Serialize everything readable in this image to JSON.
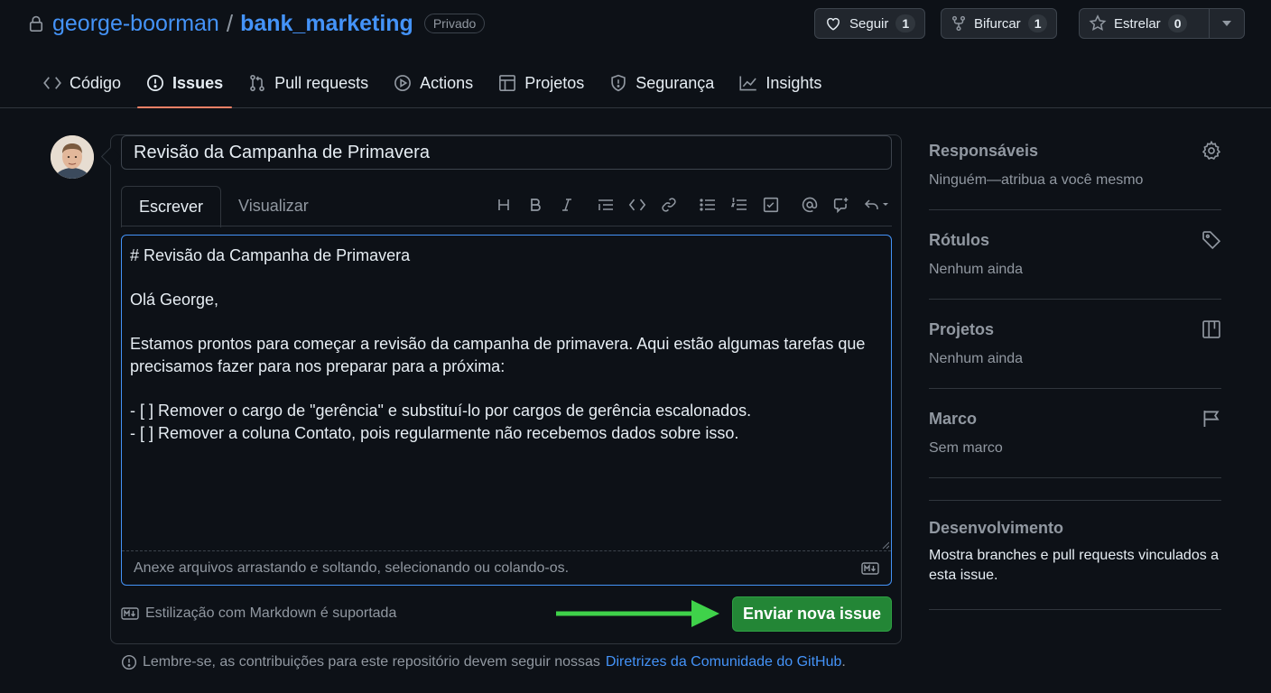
{
  "repo": {
    "owner": "george-boorman",
    "separator": "/",
    "name": "bank_marketing",
    "visibility": "Privado"
  },
  "actions": {
    "watch": {
      "label": "Seguir",
      "count": "1"
    },
    "fork": {
      "label": "Bifurcar",
      "count": "1"
    },
    "star": {
      "label": "Estrelar",
      "count": "0"
    }
  },
  "tabs": [
    {
      "label": "Código",
      "icon": "code-icon"
    },
    {
      "label": "Issues",
      "icon": "issue-icon",
      "active": true
    },
    {
      "label": "Pull requests",
      "icon": "pull-request-icon"
    },
    {
      "label": "Actions",
      "icon": "play-icon"
    },
    {
      "label": "Projetos",
      "icon": "table-icon"
    },
    {
      "label": "Segurança",
      "icon": "shield-icon"
    },
    {
      "label": "Insights",
      "icon": "graph-icon"
    }
  ],
  "issue": {
    "title": "Revisão da Campanha de Primavera",
    "body": "# Revisão da Campanha de Primavera\n\nOlá George,\n\nEstamos prontos para começar a revisão da campanha de primavera. Aqui estão algumas tarefas que precisamos fazer para nos preparar para a próxima:\n\n- [ ] Remover o cargo de \"gerência\" e substituí-lo por cargos de gerência escalonados.\n- [ ] Remover a coluna Contato, pois regularmente não recebemos dados sobre isso."
  },
  "editor": {
    "tab_write": "Escrever",
    "tab_preview": "Visualizar",
    "toolbar": [
      "heading-icon",
      "bold-icon",
      "italic-icon",
      "quote-icon",
      "code-icon",
      "link-icon",
      "unordered-list-icon",
      "ordered-list-icon",
      "task-list-icon",
      "mention-icon",
      "reference-icon",
      "undo-icon"
    ],
    "attach_hint": "Anexe arquivos arrastando e soltando, selecionando ou colando-os.",
    "markdown_note": "Estilização com Markdown é suportada",
    "submit_label": "Enviar nova issue"
  },
  "guidelines": {
    "text": "Lembre-se, as contribuições para este repositório devem seguir nossas",
    "link": "Diretrizes da Comunidade do GitHub",
    "end": "."
  },
  "sidebar": {
    "assignees": {
      "title": "Responsáveis",
      "value": "Ninguém—atribua a você mesmo"
    },
    "labels": {
      "title": "Rótulos",
      "value": "Nenhum ainda"
    },
    "projects": {
      "title": "Projetos",
      "value": "Nenhum ainda"
    },
    "milestone": {
      "title": "Marco",
      "value": "Sem marco"
    },
    "development": {
      "title": "Desenvolvimento",
      "value": "Mostra branches e pull requests vinculados a esta issue."
    }
  },
  "colors": {
    "background": "#0d1117",
    "link": "#4493f8",
    "primary_button": "#238636",
    "annotation_arrow": "#3fd24a",
    "active_tab_underline": "#f78166"
  }
}
